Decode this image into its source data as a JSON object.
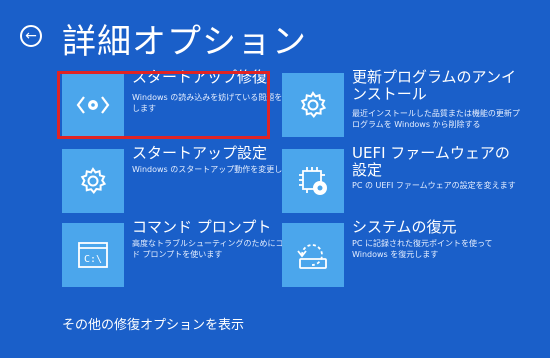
{
  "header": {
    "back_icon": "left-arrow-circle-icon",
    "title": "詳細オプション"
  },
  "options": [
    {
      "title": "スタートアップ修復",
      "description": "Windows の読み込みを妨げている問題を修正します",
      "icon": "startup-repair-icon",
      "highlighted": true
    },
    {
      "title": "更新プログラムのアンインストール",
      "description": "最近インストールした品質または機能の更新プログラムを Windows から削除する",
      "icon": "gear-icon"
    },
    {
      "title": "スタートアップ設定",
      "description": "Windows のスタートアップ動作を変更します",
      "icon": "gear-icon"
    },
    {
      "title": "UEFI ファームウェアの設定",
      "description": "PC の UEFI ファームウェアの設定を変えます",
      "icon": "chip-gear-icon"
    },
    {
      "title": "コマンド プロンプト",
      "description": "高度なトラブルシューティングのためにコマンド プロンプトを使います",
      "icon": "command-prompt-icon"
    },
    {
      "title": "システムの復元",
      "description": "PC に記録された復元ポイントを使って Windows を復元します",
      "icon": "system-restore-icon"
    }
  ],
  "footer": {
    "more_options_link": "その他の修復オプションを表示"
  },
  "colors": {
    "background": "#1a5fc9",
    "tile": "#4ba6ec",
    "highlight_border": "#e02424"
  }
}
